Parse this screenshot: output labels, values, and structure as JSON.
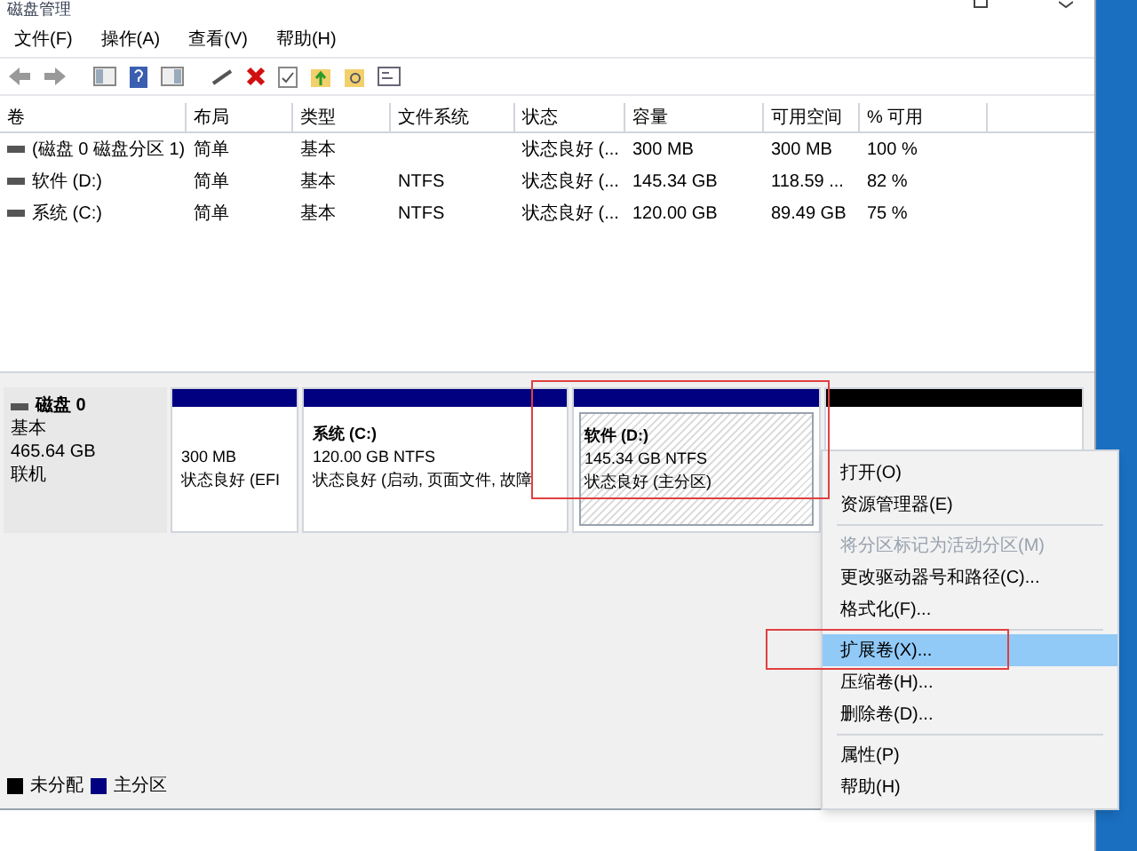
{
  "window": {
    "title": "磁盘管理"
  },
  "menu_bar": [
    "文件(F)",
    "操作(A)",
    "查看(V)",
    "帮助(H)"
  ],
  "table": {
    "columns": [
      "卷",
      "布局",
      "类型",
      "文件系统",
      "状态",
      "容量",
      "可用空间",
      "% 可用"
    ],
    "rows": [
      [
        "(磁盘 0 磁盘分区 1)",
        "简单",
        "基本",
        "",
        "状态良好 (...",
        "300 MB",
        "300 MB",
        "100 %"
      ],
      [
        "软件 (D:)",
        "简单",
        "基本",
        "NTFS",
        "状态良好 (...",
        "145.34 GB",
        "118.59 ...",
        "82 %"
      ],
      [
        "系统 (C:)",
        "简单",
        "基本",
        "NTFS",
        "状态良好 (...",
        "120.00 GB",
        "89.49 GB",
        "75 %"
      ]
    ]
  },
  "disk": {
    "name": "磁盘 0",
    "type": "基本",
    "size": "465.64 GB",
    "status": "联机",
    "partitions": [
      {
        "kind": "primary",
        "size": "300 MB",
        "status": "状态良好 (EFI",
        "selected": false
      },
      {
        "kind": "primary",
        "name": "系统 (C:)",
        "size": "120.00 GB NTFS",
        "status": "状态良好 (启动, 页面文件, 故障",
        "selected": false
      },
      {
        "kind": "primary",
        "name": "软件 (D:)",
        "size": "145.34 GB NTFS",
        "status": "状态良好 (主分区)",
        "selected": true
      },
      {
        "kind": "unallocated",
        "selected": false
      }
    ]
  },
  "context_menu": [
    {
      "kind": "item",
      "label": "打开(O)",
      "disabled": false,
      "selected": false
    },
    {
      "kind": "item",
      "label": "资源管理器(E)",
      "disabled": false,
      "selected": false
    },
    {
      "kind": "separator"
    },
    {
      "kind": "item",
      "label": "将分区标记为活动分区(M)",
      "disabled": true,
      "selected": false
    },
    {
      "kind": "item",
      "label": "更改驱动器号和路径(C)...",
      "disabled": false,
      "selected": false
    },
    {
      "kind": "item",
      "label": "格式化(F)...",
      "disabled": false,
      "selected": false
    },
    {
      "kind": "separator"
    },
    {
      "kind": "item",
      "label": "扩展卷(X)...",
      "disabled": false,
      "selected": true
    },
    {
      "kind": "item",
      "label": "压缩卷(H)...",
      "disabled": false,
      "selected": false
    },
    {
      "kind": "item",
      "label": "删除卷(D)...",
      "disabled": false,
      "selected": false
    },
    {
      "kind": "separator"
    },
    {
      "kind": "item",
      "label": "属性(P)",
      "disabled": false,
      "selected": false
    },
    {
      "kind": "item",
      "label": "帮助(H)",
      "disabled": false,
      "selected": false
    }
  ],
  "legend": [
    {
      "label": "未分配",
      "color": "#000000"
    },
    {
      "label": "主分区",
      "color": "#000080"
    }
  ]
}
